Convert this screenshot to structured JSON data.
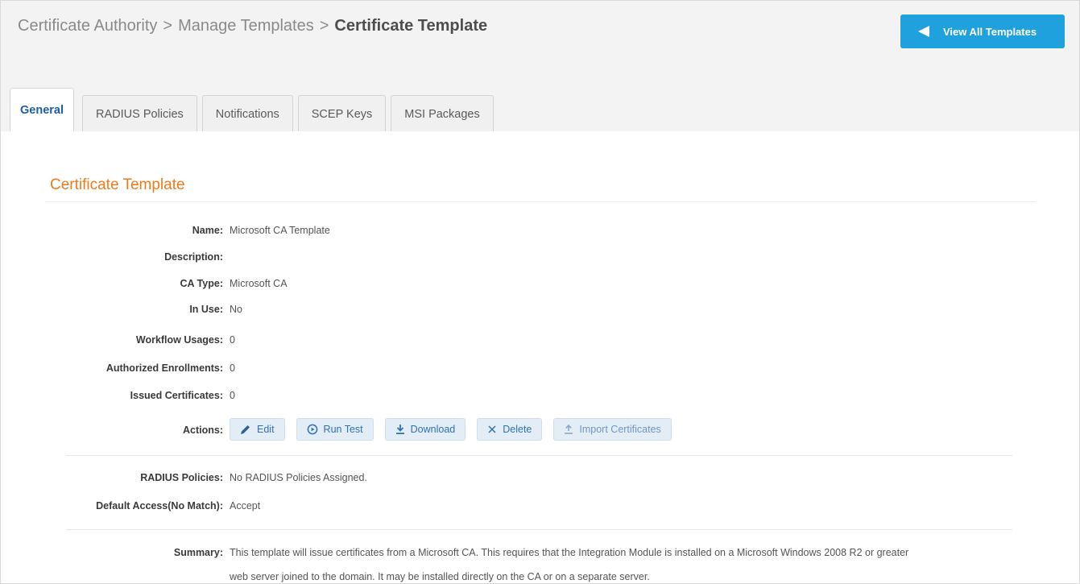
{
  "breadcrumb": {
    "items": [
      "Certificate Authority",
      "Manage Templates",
      "Certificate Template"
    ],
    "separator": ">"
  },
  "header": {
    "view_all_label": "View All Templates",
    "view_all_icon": "left-triangle-icon",
    "accent_color": "#1ea1dd"
  },
  "tabs": [
    {
      "label": "General",
      "active": true
    },
    {
      "label": "RADIUS Policies",
      "active": false
    },
    {
      "label": "Notifications",
      "active": false
    },
    {
      "label": "SCEP Keys",
      "active": false
    },
    {
      "label": "MSI Packages",
      "active": false
    }
  ],
  "section": {
    "title": "Certificate Template",
    "title_color": "#f07a1a"
  },
  "details": {
    "name": {
      "label": "Name:",
      "value": "Microsoft CA Template"
    },
    "description": {
      "label": "Description:",
      "value": ""
    },
    "ca_type": {
      "label": "CA Type:",
      "value": "Microsoft CA"
    },
    "in_use": {
      "label": "In Use:",
      "value": "No"
    },
    "workflow_usages": {
      "label": "Workflow Usages:",
      "value": "0"
    },
    "authorized_enrollments": {
      "label": "Authorized Enrollments:",
      "value": "0"
    },
    "issued_certificates": {
      "label": "Issued Certificates:",
      "value": "0"
    }
  },
  "actions": {
    "label": "Actions:",
    "buttons": [
      {
        "label": "Edit",
        "icon": "pencil-icon"
      },
      {
        "label": "Run Test",
        "icon": "play-circle-icon"
      },
      {
        "label": "Download",
        "icon": "download-icon"
      },
      {
        "label": "Delete",
        "icon": "close-icon"
      },
      {
        "label": "Import Certificates",
        "icon": "upload-icon"
      }
    ]
  },
  "radius": {
    "policies": {
      "label": "RADIUS Policies:",
      "value": "No RADIUS Policies Assigned."
    },
    "default_access": {
      "label": "Default Access(No Match):",
      "value": "Accept"
    }
  },
  "summary": {
    "label": "Summary:",
    "line1": "This template will issue certificates from a Microsoft CA. This requires that the Integration Module is installed on a Microsoft Windows 2008 R2 or greater",
    "line2": "web server joined to the domain. It may be installed directly on the CA or on a separate server."
  }
}
